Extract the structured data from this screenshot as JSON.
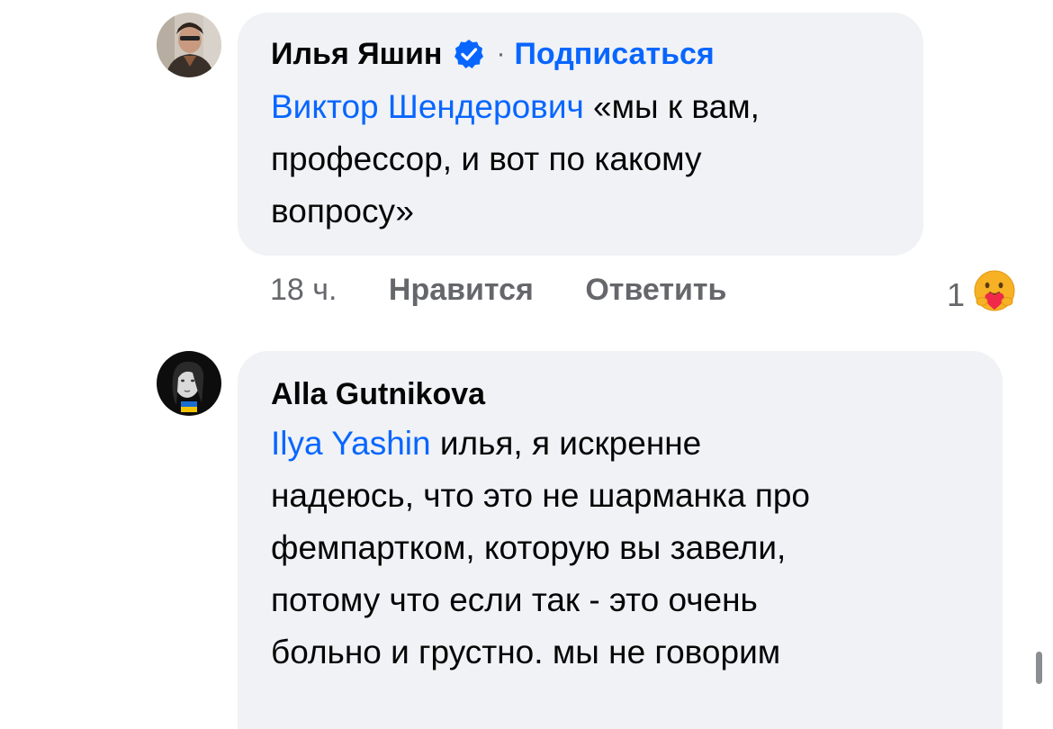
{
  "comments": [
    {
      "author": "Илья Яшин",
      "verified": true,
      "separator": "·",
      "subscribe_label": "Подписаться",
      "mention": "Виктор Шендерович",
      "text_lines": [
        " «мы к вам,",
        "профессор, и вот по какому",
        "вопросу»"
      ],
      "time": "18 ч.",
      "like_label": "Нравится",
      "reply_label": "Ответить",
      "reaction_count": "1",
      "reaction_icon": "care-reaction-icon"
    },
    {
      "author": "Alla Gutnikova",
      "mention": "Ilya Yashin",
      "text_lines": [
        " илья, я искренне",
        "надеюсь, что это не шарманка про",
        "фемпартком, которую вы завели,",
        "потому что если так - это очень",
        "больно и грустно. мы не говорим"
      ]
    }
  ],
  "colors": {
    "link": "#0866ff",
    "bubble": "#f0f2f5",
    "meta": "#65676b",
    "text": "#050505"
  }
}
